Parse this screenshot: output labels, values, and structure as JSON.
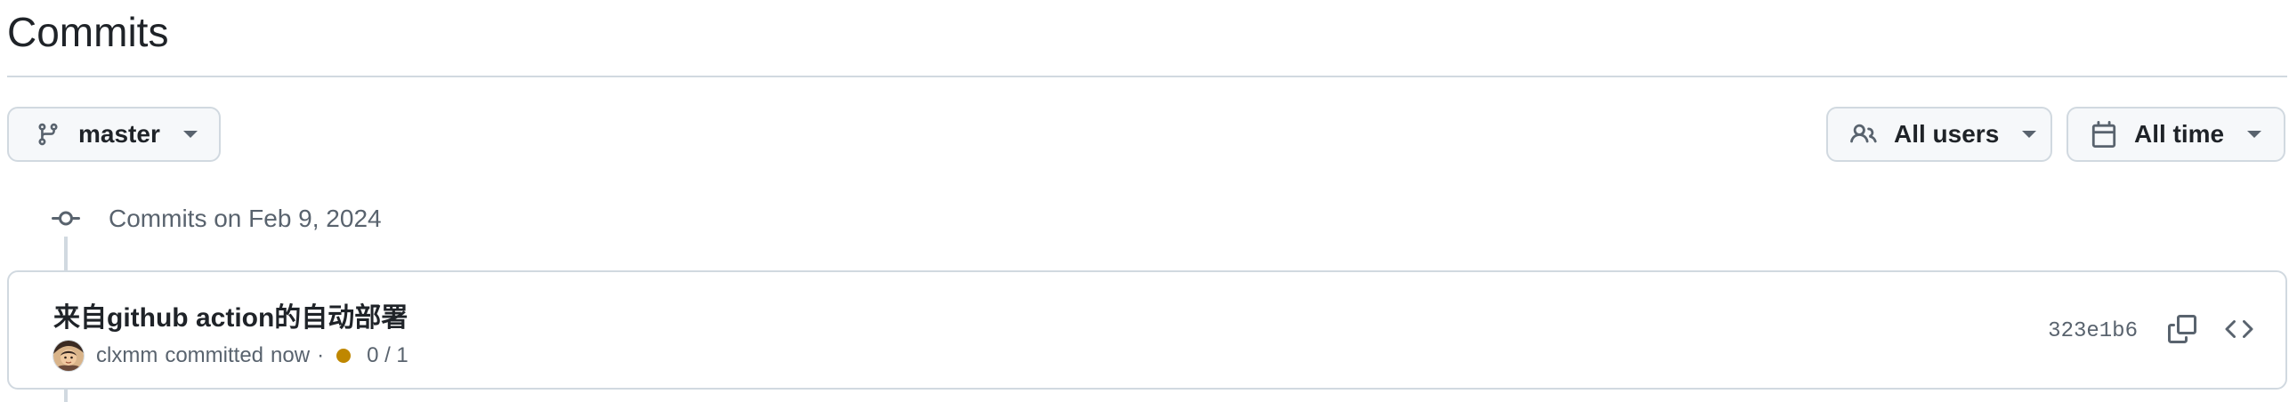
{
  "page": {
    "title": "Commits"
  },
  "filters": {
    "branch": {
      "label": "master",
      "icon": "git-branch-icon"
    },
    "users": {
      "label": "All users",
      "icon": "people-icon"
    },
    "time": {
      "label": "All time",
      "icon": "calendar-icon"
    }
  },
  "commit_groups": [
    {
      "label": "Commits on Feb 9, 2024",
      "icon": "git-commit-icon",
      "commits": [
        {
          "message": "来自github action的自动部署",
          "author": "clxmm",
          "action": "committed",
          "time": "now",
          "separator": "·",
          "status": {
            "color": "#bf8700",
            "checks": "0 / 1"
          },
          "sha": "323e1b6",
          "actions": {
            "copy_icon": "copy-icon",
            "browse_icon": "code-icon"
          }
        }
      ]
    }
  ],
  "colors": {
    "border": "#d1d9e0",
    "button_bg": "#f6f8fa",
    "text": "#1f2328",
    "muted_text": "#59636e",
    "pending": "#bf8700"
  }
}
